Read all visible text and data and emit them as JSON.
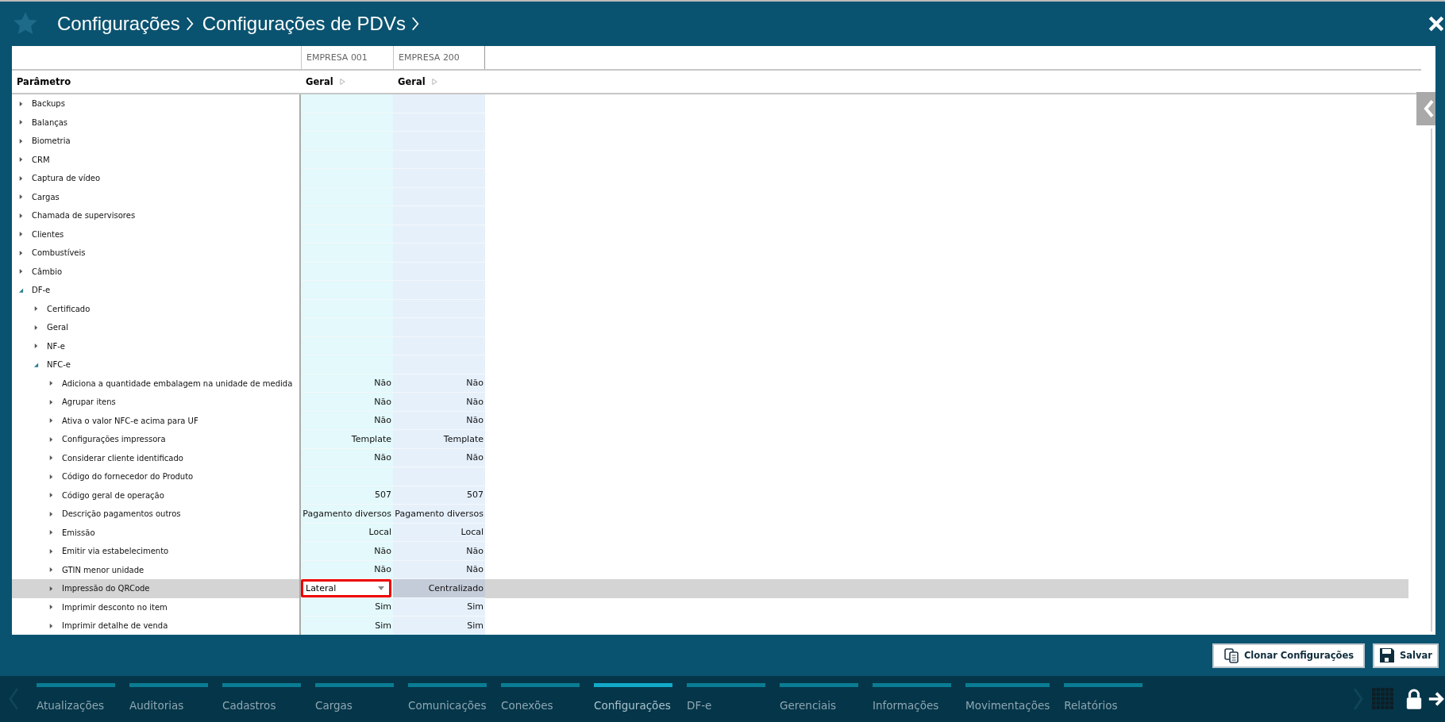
{
  "header": {
    "breadcrumb": [
      "Configurações",
      "Configurações de PDVs"
    ]
  },
  "table": {
    "parameter_heading": "Parâmetro",
    "columns": [
      {
        "company": "EMPRESA 001",
        "group": "Geral"
      },
      {
        "company": "EMPRESA 200",
        "group": "Geral"
      }
    ],
    "rows": [
      {
        "label": "Backups",
        "expanded": false,
        "selected": false
      },
      {
        "label": "Balanças",
        "expanded": false,
        "selected": false
      },
      {
        "label": "Biometria",
        "expanded": false,
        "selected": false
      },
      {
        "label": "CRM",
        "expanded": false,
        "selected": false
      },
      {
        "label": "Captura de vídeo",
        "expanded": false,
        "selected": false
      },
      {
        "label": "Cargas",
        "expanded": false,
        "selected": false
      },
      {
        "label": "Chamada de supervisores",
        "expanded": false,
        "selected": false
      },
      {
        "label": "Clientes",
        "expanded": false,
        "selected": false
      },
      {
        "label": "Combustíveis",
        "expanded": false,
        "selected": false
      },
      {
        "label": "Câmbio",
        "expanded": false,
        "selected": false
      },
      {
        "label": "DF-e",
        "expanded": true,
        "selected": false,
        "children": [
          {
            "label": "Certificado",
            "expanded": false,
            "selected": false
          },
          {
            "label": "Geral",
            "expanded": false,
            "selected": false
          },
          {
            "label": "NF-e",
            "expanded": false,
            "selected": false
          },
          {
            "label": "NFC-e",
            "expanded": true,
            "selected": false,
            "children": [
              {
                "label": "Adiciona a quantidade embalagem na unidade de medida",
                "expanded": false,
                "selected": false,
                "cells": [
                  {
                    "kind": "text",
                    "text": "Não"
                  },
                  {
                    "kind": "text",
                    "text": "Não"
                  }
                ]
              },
              {
                "label": "Agrupar itens",
                "expanded": false,
                "selected": false,
                "cells": [
                  {
                    "kind": "text",
                    "text": "Não"
                  },
                  {
                    "kind": "text",
                    "text": "Não"
                  }
                ]
              },
              {
                "label": "Ativa o valor NFC-e acima para UF",
                "expanded": false,
                "selected": false,
                "cells": [
                  {
                    "kind": "text",
                    "text": "Não"
                  },
                  {
                    "kind": "text",
                    "text": "Não"
                  }
                ]
              },
              {
                "label": "Configurações impressora",
                "expanded": false,
                "selected": false,
                "cells": [
                  {
                    "kind": "text",
                    "text": "Template"
                  },
                  {
                    "kind": "text",
                    "text": "Template"
                  }
                ]
              },
              {
                "label": "Considerar cliente identificado",
                "expanded": false,
                "selected": false,
                "cells": [
                  {
                    "kind": "text",
                    "text": "Não"
                  },
                  {
                    "kind": "text",
                    "text": "Não"
                  }
                ]
              },
              {
                "label": "Código do fornecedor do Produto",
                "expanded": false,
                "selected": false
              },
              {
                "label": "Código geral de operação",
                "expanded": false,
                "selected": false,
                "cells": [
                  {
                    "kind": "text",
                    "text": "507"
                  },
                  {
                    "kind": "text",
                    "text": "507"
                  }
                ]
              },
              {
                "label": "Descrição pagamentos outros",
                "expanded": false,
                "selected": false,
                "cells": [
                  {
                    "kind": "text",
                    "text": "Pagamento diversos"
                  },
                  {
                    "kind": "text",
                    "text": "Pagamento diversos"
                  }
                ]
              },
              {
                "label": "Emissão",
                "expanded": false,
                "selected": false,
                "cells": [
                  {
                    "kind": "text",
                    "text": "Local"
                  },
                  {
                    "kind": "text",
                    "text": "Local"
                  }
                ]
              },
              {
                "label": "Emitir via estabelecimento",
                "expanded": false,
                "selected": false,
                "cells": [
                  {
                    "kind": "text",
                    "text": "Não"
                  },
                  {
                    "kind": "text",
                    "text": "Não"
                  }
                ]
              },
              {
                "label": "GTIN menor unidade",
                "expanded": false,
                "selected": false,
                "cells": [
                  {
                    "kind": "text",
                    "text": "Não"
                  },
                  {
                    "kind": "text",
                    "text": "Não"
                  }
                ]
              },
              {
                "label": "Impressão do QRCode",
                "expanded": false,
                "selected": true,
                "cells": [
                  {
                    "kind": "dropdown",
                    "text": "Lateral"
                  },
                  {
                    "kind": "text",
                    "text": "Centralizado"
                  }
                ]
              },
              {
                "label": "Imprimir desconto no item",
                "expanded": false,
                "selected": false,
                "cells": [
                  {
                    "kind": "text",
                    "text": "Sim"
                  },
                  {
                    "kind": "text",
                    "text": "Sim"
                  }
                ]
              },
              {
                "label": "Imprimir detalhe de venda",
                "expanded": false,
                "selected": false,
                "cells": [
                  {
                    "kind": "text",
                    "text": "Sim"
                  },
                  {
                    "kind": "text",
                    "text": "Sim"
                  }
                ]
              }
            ]
          }
        ]
      }
    ]
  },
  "actions": [
    {
      "kind": "clone",
      "label": "Clonar Configurações"
    },
    {
      "kind": "save",
      "label": "Salvar"
    }
  ],
  "nav": [
    {
      "label": "Atualizações",
      "selected": false
    },
    {
      "label": "Auditorias",
      "selected": false
    },
    {
      "label": "Cadastros",
      "selected": false
    },
    {
      "label": "Cargas",
      "selected": false
    },
    {
      "label": "Comunicações",
      "selected": false
    },
    {
      "label": "Conexões",
      "selected": false
    },
    {
      "label": "Configurações",
      "selected": true
    },
    {
      "label": "DF-e",
      "selected": false
    },
    {
      "label": "Gerenciais",
      "selected": false
    },
    {
      "label": "Informações",
      "selected": false
    },
    {
      "label": "Movimentações",
      "selected": false
    },
    {
      "label": "Relatórios",
      "selected": false
    }
  ]
}
